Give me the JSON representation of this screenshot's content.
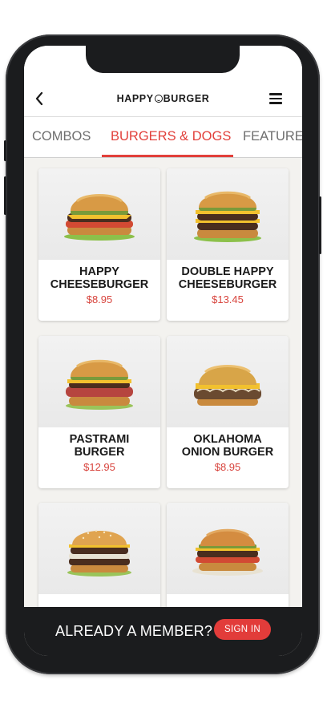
{
  "header": {
    "logo_left": "HAPPY",
    "logo_right": "BURGER",
    "back_icon": "chevron-left-icon",
    "menu_icon": "hamburger-menu-icon"
  },
  "tabs": [
    {
      "label": "COMBOS",
      "active": false
    },
    {
      "label": "BURGERS & DOGS",
      "active": true
    },
    {
      "label": "FEATURE",
      "active": false
    }
  ],
  "menu_items": [
    {
      "name": "HAPPY\nCHEESEBURGER",
      "price": "$8.95"
    },
    {
      "name": "DOUBLE HAPPY\nCHEESEBURGER",
      "price": "$13.45"
    },
    {
      "name": "PASTRAMI\nBURGER",
      "price": "$12.95"
    },
    {
      "name": "OKLAHOMA\nONION BURGER",
      "price": "$8.95"
    },
    {
      "name": "",
      "price": ""
    },
    {
      "name": "",
      "price": ""
    }
  ],
  "footer": {
    "prompt": "ALREADY A MEMBER?",
    "signin_label": "SIGN IN"
  },
  "colors": {
    "accent": "#e2403b",
    "price": "#d8453e",
    "footer_bg": "#1b1c1e",
    "screen_bg": "#f3f2ef"
  }
}
